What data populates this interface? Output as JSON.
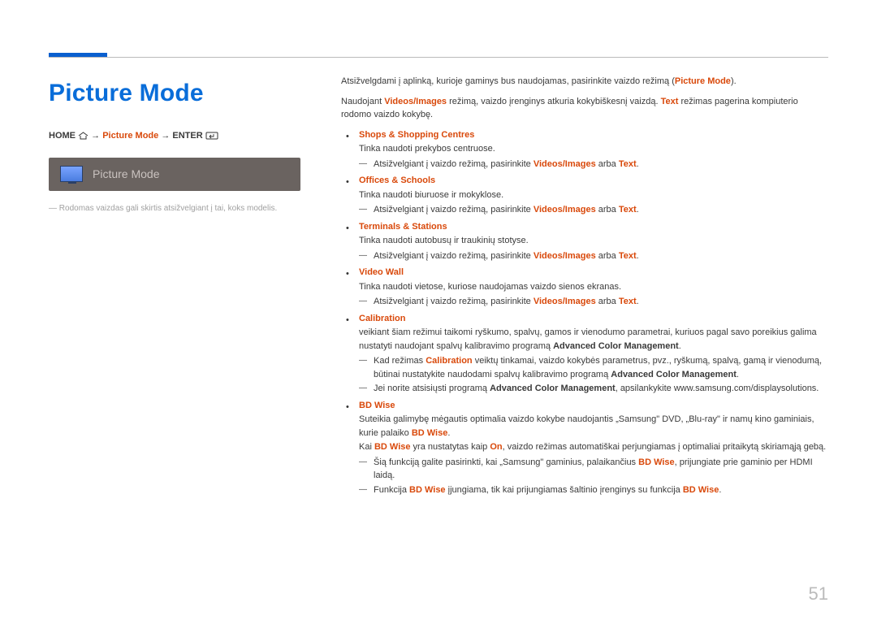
{
  "page_number": "51",
  "title": "Picture Mode",
  "nav": {
    "home": "HOME",
    "arrow": " → ",
    "mid": "Picture Mode",
    "enter": "ENTER"
  },
  "ui_preview_label": "Picture Mode",
  "footnote": "Rodomas vaizdas gali skirtis atsižvelgiant į tai, koks modelis.",
  "intro1_pre": "Atsižvelgdami į aplinką, kurioje gaminys bus naudojamas, pasirinkite vaizdo režimą (",
  "intro1_accent": "Picture Mode",
  "intro1_post": ").",
  "intro2_a": "Naudojant ",
  "intro2_b": "Videos/Images",
  "intro2_c": " režimą, vaizdo įrenginys atkuria kokybiškesnį vaizdą. ",
  "intro2_d": "Text",
  "intro2_e": " režimas pagerina kompiuterio rodomo vaizdo kokybę.",
  "modes": [
    {
      "head": "Shops & Shopping Centres",
      "head_color": "accent",
      "desc": "Tinka naudoti prekybos centruose.",
      "subs": [
        {
          "a": "Atsižvelgiant į vaizdo režimą, pasirinkite ",
          "b": "Videos/Images",
          "c": " arba ",
          "d": "Text",
          "e": "."
        }
      ]
    },
    {
      "head": "Offices & Schools",
      "head_color": "accent",
      "desc": "Tinka naudoti biuruose ir mokyklose.",
      "subs": [
        {
          "a": "Atsižvelgiant į vaizdo režimą, pasirinkite ",
          "b": "Videos/Images",
          "c": " arba ",
          "d": "Text",
          "e": "."
        }
      ]
    },
    {
      "head": "Terminals & Stations",
      "head_color": "accent",
      "desc": "Tinka naudoti autobusų ir traukinių stotyse.",
      "subs": [
        {
          "a": "Atsižvelgiant į vaizdo režimą, pasirinkite ",
          "b": "Videos/Images",
          "c": " arba ",
          "d": "Text",
          "e": "."
        }
      ]
    },
    {
      "head": "Video Wall",
      "head_color": "accent",
      "desc": "Tinka naudoti vietose, kuriose naudojamas vaizdo sienos ekranas.",
      "subs": [
        {
          "a": "Atsižvelgiant į vaizdo režimą, pasirinkite ",
          "b": "Videos/Images",
          "c": " arba ",
          "d": "Text",
          "e": "."
        }
      ]
    }
  ],
  "calibration": {
    "head": "Calibration",
    "desc_a": "veikiant šiam režimui taikomi ryškumo, spalvų, gamos ir vienodumo parametrai, kuriuos pagal savo poreikius galima nustatyti naudojant spalvų kalibravimo programą ",
    "desc_b": "Advanced Color Management",
    "desc_c": ".",
    "subs": [
      {
        "a": "Kad režimas ",
        "b": "Calibration",
        "c": " veiktų tinkamai, vaizdo kokybės parametrus, pvz., ryškumą, spalvą, gamą ir vienodumą, būtinai nustatykite naudodami spalvų kalibravimo programą ",
        "d": "Advanced Color Management",
        "e": "."
      },
      {
        "a": "Jei norite atsisiųsti programą ",
        "b": "Advanced Color Management",
        "c": ", apsilankykite www.samsung.com/displaysolutions.",
        "d": "",
        "e": ""
      }
    ]
  },
  "bdwise": {
    "head": "BD Wise",
    "desc_a": "Suteikia galimybę mėgautis optimalia vaizdo kokybe naudojantis „Samsung\" DVD, „Blu-ray\" ir namų kino gaminiais, kurie palaiko ",
    "desc_b": "BD Wise",
    "desc_c": ".",
    "line2_a": "Kai ",
    "line2_b": "BD Wise",
    "line2_c": " yra nustatytas kaip ",
    "line2_d": "On",
    "line2_e": ", vaizdo režimas automatiškai perjungiamas į optimaliai pritaikytą skiriamąją gebą.",
    "subs": [
      {
        "a": "Šią funkciją galite pasirinkti, kai „Samsung\" gaminius, palaikančius ",
        "b": "BD Wise",
        "c": ", prijungiate prie gaminio per HDMI laidą.",
        "d": "",
        "e": ""
      },
      {
        "a": "Funkcija ",
        "b": "BD Wise",
        "c": " įjungiama, tik kai prijungiamas šaltinio įrenginys su funkcija ",
        "d": "BD Wise",
        "e": "."
      }
    ]
  }
}
